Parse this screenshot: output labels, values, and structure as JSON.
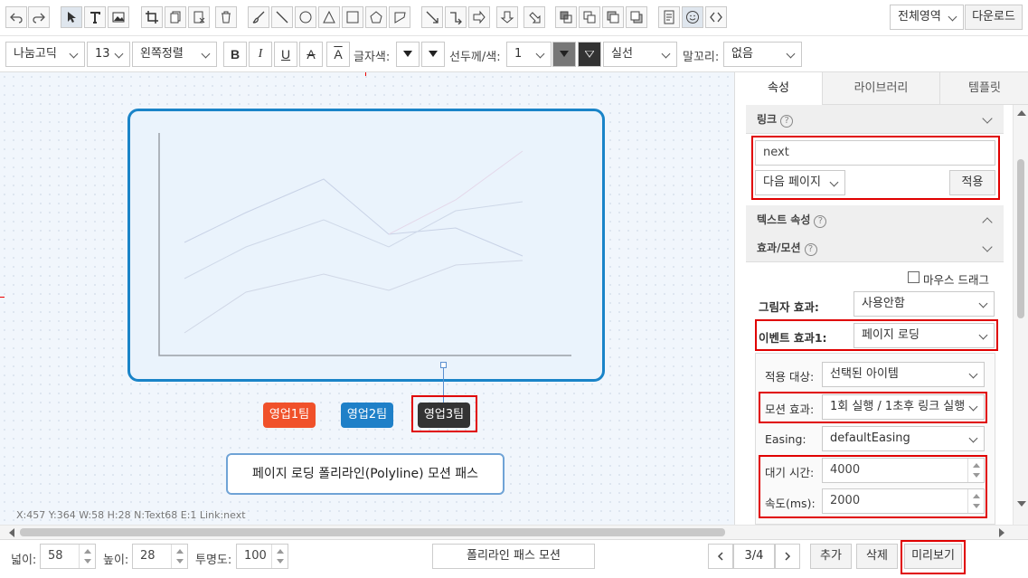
{
  "toolbar": {
    "area_select": "전체영역",
    "download": "다운로드"
  },
  "format": {
    "font": "나눔고딕",
    "size": "13",
    "align": "왼쪽정렬",
    "bold": "B",
    "italic": "I",
    "underline": "U",
    "strike": "A",
    "overline": "A",
    "text_color_label": "글자색:",
    "line_label": "선두께/색:",
    "line_width": "1",
    "line_style": "실선",
    "tail_label": "말꼬리:",
    "tail_value": "없음"
  },
  "canvas": {
    "buttons": [
      {
        "label": "영업1팀",
        "color": "#f0512a"
      },
      {
        "label": "영업2팀",
        "color": "#1f80c8"
      },
      {
        "label": "영업3팀",
        "color": "#333333"
      }
    ],
    "caption": "페이지 로딩 폴리라인(Polyline) 모션 패스",
    "status": "X:457 Y:364 W:58 H:28 N:Text68 E:1 Link:next"
  },
  "panel": {
    "tabs": [
      "속성",
      "라이브러리",
      "템플릿"
    ],
    "link_section": "링크",
    "link_value": "next",
    "link_type": "다음 페이지",
    "apply": "적용",
    "text_section": "텍스트 속성",
    "effect_section": "효과/모션",
    "mouse_drag": "마우스 드래그",
    "shadow_label": "그림자 효과:",
    "shadow_value": "사용안함",
    "event_label": "이벤트 효과1:",
    "event_value": "페이지 로딩",
    "target_label": "적용 대상:",
    "target_value": "선택된 아이템",
    "motion_label": "모션 효과:",
    "motion_value": "1회 실행 / 1초후 링크 실행",
    "easing_label": "Easing:",
    "easing_value": "defaultEasing",
    "wait_label": "대기 시간:",
    "wait_value": "4000",
    "speed_label": "속도(ms):",
    "speed_value": "2000"
  },
  "bottom": {
    "width_label": "넓이:",
    "width_value": "58",
    "height_label": "높이:",
    "height_value": "28",
    "opacity_label": "투명도:",
    "opacity_value": "100",
    "page_title": "폴리라인 패스 모션",
    "page_indicator": "3/4",
    "add": "추가",
    "delete": "삭제",
    "preview": "미리보기"
  },
  "icons": [
    "undo-icon",
    "redo-icon",
    "pointer-icon",
    "text-icon",
    "image-icon",
    "crop-icon",
    "copy-icon",
    "delete-copy-icon",
    "trash-icon",
    "brush-icon",
    "line-icon",
    "circle-icon",
    "triangle-icon",
    "square-icon",
    "pentagon-icon",
    "polyline-icon",
    "arrow-line-icon",
    "elbow-line-icon",
    "arrow-right-icon",
    "arrow-down-icon",
    "arrow-diagonal-icon",
    "bring-front-icon",
    "send-back-icon",
    "bring-forward-icon",
    "send-backward-icon",
    "css-icon",
    "emoji-icon",
    "code-icon"
  ]
}
